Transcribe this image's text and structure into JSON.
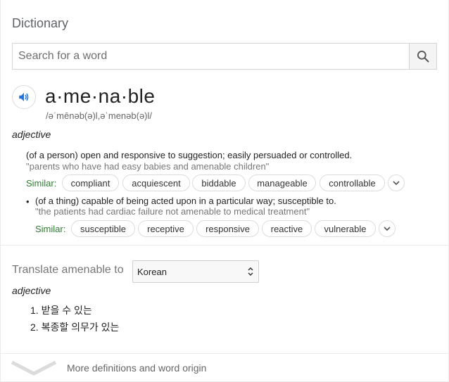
{
  "app": {
    "title": "Dictionary"
  },
  "search": {
    "placeholder": "Search for a word",
    "value": "",
    "icon": "search-icon"
  },
  "entry": {
    "headword": "a·me·na·ble",
    "pronunciation": "/əˈmēnəb(ə)l,əˈmenəb(ə)l/",
    "part_of_speech": "adjective",
    "senses": [
      {
        "definition": "(of a person) open and responsive to suggestion; easily persuaded or controlled.",
        "example": "\"parents who have had easy babies and amenable children\"",
        "similar_label": "Similar:",
        "similar": [
          "compliant",
          "acquiescent",
          "biddable",
          "manageable",
          "controllable"
        ]
      },
      {
        "bullet": "•",
        "definition": "(of a thing) capable of being acted upon in a particular way; susceptible to.",
        "example": "\"the patients had cardiac failure not amenable to medical treatment\"",
        "similar_label": "Similar:",
        "similar": [
          "susceptible",
          "receptive",
          "responsive",
          "reactive",
          "vulnerable"
        ]
      }
    ]
  },
  "translate": {
    "label": "Translate amenable to",
    "language": "Korean",
    "part_of_speech": "adjective",
    "items": [
      "1. 받을 수 있는",
      "2. 복종할 의무가 있는"
    ]
  },
  "footer": {
    "more_label": "More definitions and word origin"
  },
  "colors": {
    "similar_label": "#2e7d32",
    "speaker_blue": "#1a73e8"
  }
}
